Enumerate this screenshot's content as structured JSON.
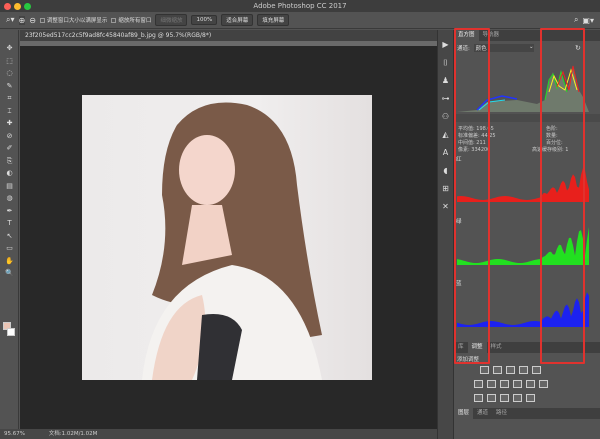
{
  "window": {
    "title": "Adobe Photoshop CC 2017"
  },
  "options_bar": {
    "resize_windows": "调整窗口大小以满屏显示",
    "zoom_all": "缩放所有窗口",
    "scrubby_zoom": "细微缩放",
    "zoom_100": "100%",
    "fit_screen": "适合屏幕",
    "fill_screen": "填充屏幕"
  },
  "document": {
    "tab": "23f205ed517cc2c5f9ad8fc45840af89_b.jpg @ 95.7%(RGB/8*)"
  },
  "status": {
    "zoom": "95.67%",
    "doc_size": "文档:1.02M/1.02M"
  },
  "tools": [
    "✥",
    "⬚",
    "◌",
    "✎",
    "⌗",
    "⌶",
    "✚",
    "⊘",
    "✐",
    "⎘",
    "◐",
    "▤",
    "◍",
    "✒",
    "T",
    "↖",
    "▭",
    "✋",
    "🔍"
  ],
  "histogram_panel": {
    "tabs": [
      "直方图",
      "导航器"
    ],
    "channel_label": "通道:",
    "channel_value": "颜色",
    "stats": {
      "mean_label": "平均值:",
      "mean": "198.65",
      "std_label": "标准偏差:",
      "std": "44.25",
      "median_label": "中间值:",
      "median": "211",
      "pixels_label": "像素:",
      "pixels": "334200",
      "level_label": "色阶:",
      "count_label": "数量:",
      "percentile_label": "百分位:",
      "cache_label": "高速缓存级别:",
      "cache": "1"
    },
    "channels": [
      "红",
      "绿",
      "蓝"
    ]
  },
  "adjust_panel": {
    "tabs": [
      "库",
      "调整",
      "样式"
    ],
    "add_label": "添加调整"
  },
  "layers_panel": {
    "tabs": [
      "图层",
      "通道",
      "路径"
    ]
  },
  "colors": {
    "red": "#e8201c",
    "green": "#22e020",
    "blue": "#1c22f0",
    "highlight": "#e0322e"
  }
}
